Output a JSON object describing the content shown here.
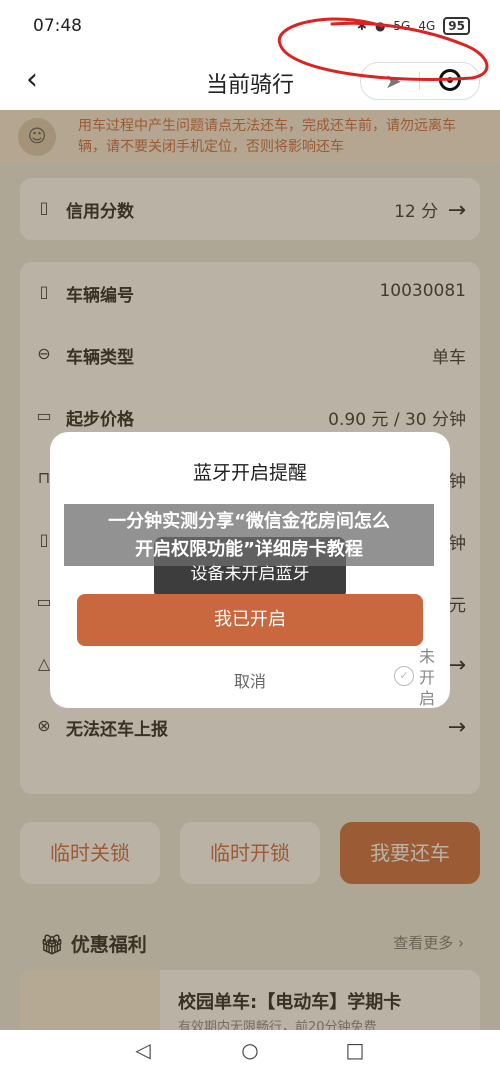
{
  "status_bar": {
    "time": "07:48",
    "indicators": [
      "5G",
      "4G"
    ],
    "battery": "95"
  },
  "nav": {
    "title": "当前骑行"
  },
  "notice": {
    "text": "用车过程中产生问题请点无法还车，完成还车前，请勿远离车辆，请不要关闭手机定位，否则将影响还车"
  },
  "credit": {
    "label": "信用分数",
    "value": "12 分"
  },
  "info_rows": [
    {
      "icon": "bookmark-icon",
      "label": "车辆编号",
      "value": "10030081"
    },
    {
      "icon": "minus-circle-icon",
      "label": "车辆类型",
      "value": "单车"
    },
    {
      "icon": "ticket-icon",
      "label": "起步价格",
      "value": "0.90 元 / 30 分钟"
    },
    {
      "icon": "bag-icon",
      "label": "",
      "value": "钟"
    },
    {
      "icon": "bookmark-icon",
      "label": "",
      "value": "钟"
    },
    {
      "icon": "ticket-icon",
      "label": "",
      "value": "元"
    },
    {
      "icon": "warning-icon",
      "label": "",
      "value": ""
    },
    {
      "icon": "x-circle-icon",
      "label": "无法还车上报",
      "value": ""
    }
  ],
  "actions": {
    "lock": "临时关锁",
    "unlock": "临时开锁",
    "return": "我要还车"
  },
  "promo": {
    "heading": "优惠福利",
    "more": "查看更多",
    "title": "校园单车:【电动车】学期卡",
    "subtitle": "有效期内无限畅行，前20分钟免费"
  },
  "modal": {
    "title": "蓝牙开启提醒",
    "toast": "设备未开启蓝牙",
    "confirm": "我已开启",
    "cancel": "取消",
    "status": "未开启"
  },
  "banner": {
    "line1": "一分钟实测分享“微信金花房间怎么",
    "line2": "开启权限功能”详细房卡教程"
  },
  "colors": {
    "accent": "#c9683f",
    "background": "#ecebe6"
  }
}
